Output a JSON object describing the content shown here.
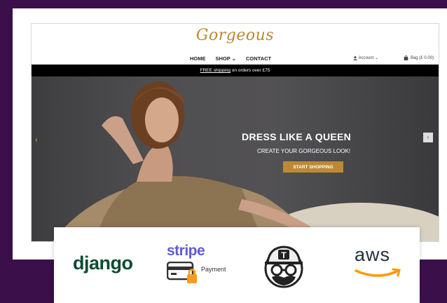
{
  "site": {
    "logo": "Gorgeous",
    "nav": [
      "HOME",
      "SHOP ⌄",
      "CONTACT"
    ],
    "account": "Account ⌄",
    "bag": "Bag (£ 0.00)",
    "banner_link": "FREE shipping",
    "banner_rest": " on orders over £75"
  },
  "hero": {
    "headline": "DRESS LIKE A QUEEN",
    "subline": "CREATE YOUR GORGEOUS LOOK!",
    "cta": "START SHOPPING",
    "arrow_left": "‹",
    "arrow_right": "›"
  },
  "logos": {
    "django": "django",
    "stripe": "stripe",
    "stripe_sub": "Payment",
    "aws": "aws"
  },
  "colors": {
    "background": "#3b0f49",
    "gold": "#bd8a33",
    "django": "#0c4b33",
    "stripe": "#5f59d4",
    "aws_arrow": "#ff9900"
  }
}
